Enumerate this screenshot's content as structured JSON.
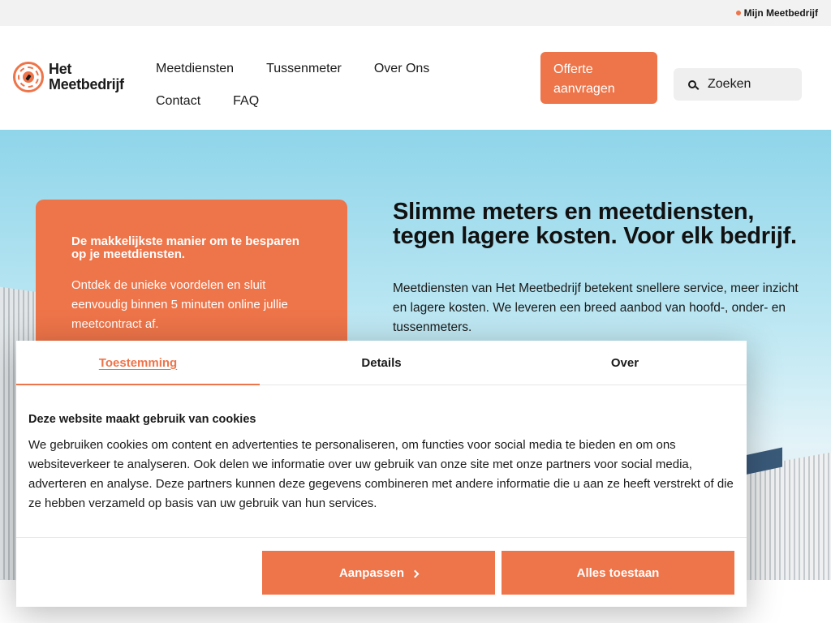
{
  "topbar": {
    "account_link": "Mijn Meetbedrijf"
  },
  "logo": {
    "line1": "Het",
    "line2": "Meetbedrijf"
  },
  "nav": {
    "items": [
      "Meetdiensten",
      "Tussenmeter",
      "Over Ons",
      "Contact",
      "FAQ"
    ]
  },
  "header": {
    "cta_label": "Offerte aanvragen",
    "search_placeholder": "Zoeken"
  },
  "hero": {
    "promo_title": "De makkelijkste manier om te besparen op je meetdiensten.",
    "promo_text": "Ontdek de unieke voordelen en sluit eenvoudig binnen 5 minuten online jullie meetcontract af.",
    "title": "Slimme meters en meetdiensten, tegen lagere kosten. Voor elk bedrijf.",
    "subtitle": "Meetdiensten van Het Meetbedrijf betekent snellere service, meer inzicht en lagere kosten. We leveren een breed aanbod van hoofd-, onder- en tussenmeters."
  },
  "cookie": {
    "tabs": [
      "Toestemming",
      "Details",
      "Over"
    ],
    "heading": "Deze website maakt gebruik van cookies",
    "text": "We gebruiken cookies om content en advertenties te personaliseren, om functies voor social media te bieden en om ons websiteverkeer te analyseren. Ook delen we informatie over uw gebruik van onze site met onze partners voor social media, adverteren en analyse. Deze partners kunnen deze gegevens combineren met andere informatie die u aan ze heeft verstrekt of die ze hebben verzameld op basis van uw gebruik van hun services.",
    "customize_label": "Aanpassen",
    "accept_label": "Alles toestaan"
  },
  "colors": {
    "accent": "#ee7449"
  }
}
